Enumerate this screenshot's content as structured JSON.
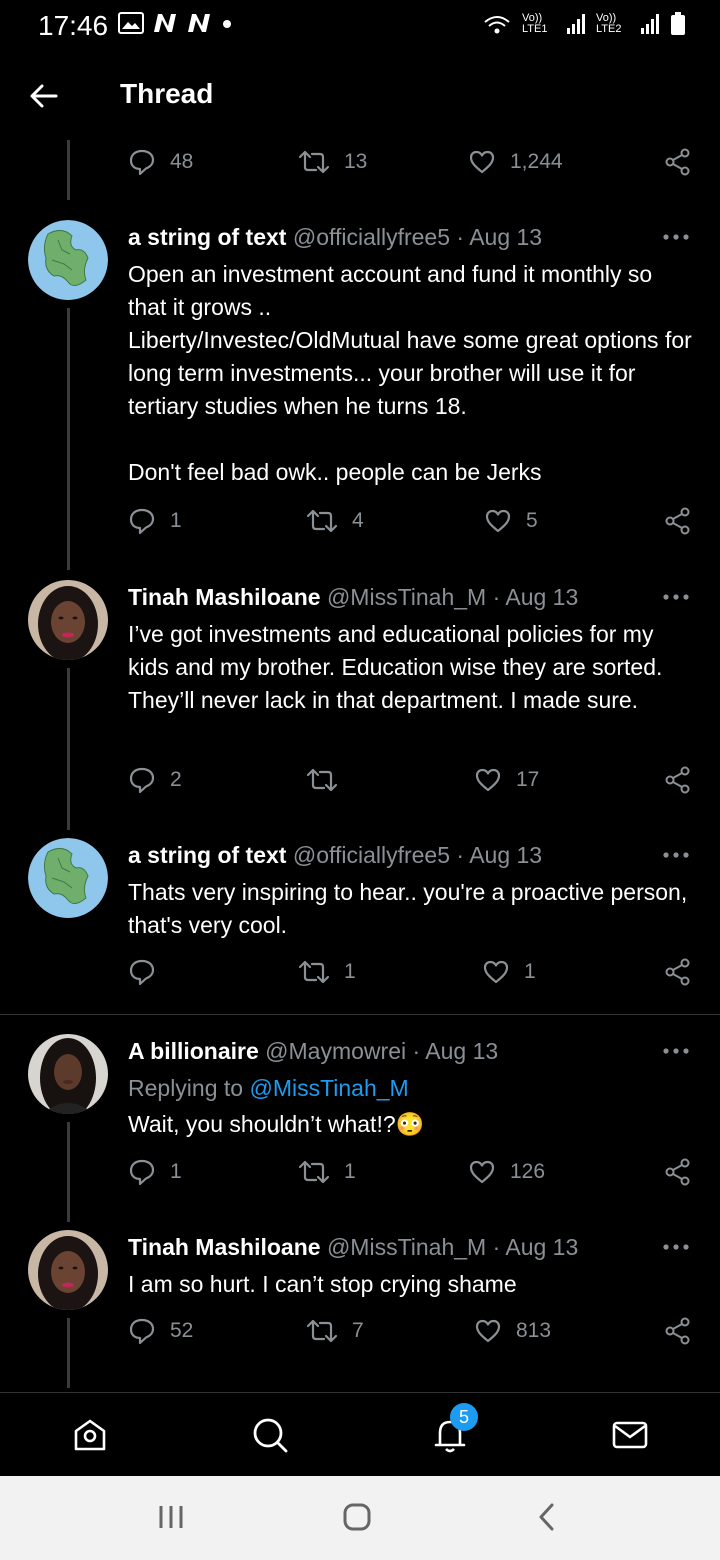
{
  "status_bar": {
    "time": "17:46",
    "net1": "Vo)) LTE1",
    "net2": "Vo)) LTE2"
  },
  "header": {
    "title": "Thread"
  },
  "top_actions": {
    "replies": "48",
    "retweets": "13",
    "likes": "1,244"
  },
  "tweets": [
    {
      "name": "a string of text",
      "meta": "@officiallyfree5 · Aug 13",
      "reply_to_prefix": "",
      "reply_to_handle": "",
      "body": "Open an investment account and fund it monthly so that it grows ..\nLiberty/Investec/OldMutual have some great options for long term investments... your brother will use it for tertiary studies when he turns 18.\n\nDon't feel bad owk.. people can be Jerks",
      "replies": "1",
      "retweets": "4",
      "likes": "5",
      "avatar": "globe-avatar"
    },
    {
      "name": "Tinah Mashiloane",
      "meta": "@MissTinah_M · Aug 13",
      "reply_to_prefix": "",
      "reply_to_handle": "",
      "body": "I’ve got investments and educational policies for my kids and my brother. Education wise they are sorted. They’ll never lack in that department. I made sure.",
      "replies": "2",
      "retweets": "",
      "likes": "17",
      "avatar": "woman-avatar"
    },
    {
      "name": "a string of text",
      "meta": "@officiallyfree5 · Aug 13",
      "reply_to_prefix": "",
      "reply_to_handle": "",
      "body": "Thats very inspiring to hear.. you're a proactive person, that's very cool.",
      "replies": "",
      "retweets": "1",
      "likes": "1",
      "avatar": "globe-avatar"
    },
    {
      "name": "A billionaire",
      "meta": "@Maymowrei · Aug 13",
      "reply_to_prefix": "Replying to ",
      "reply_to_handle": "@MissTinah_M",
      "body": "Wait, you shouldn’t what!?😳",
      "replies": "1",
      "retweets": "1",
      "likes": "126",
      "avatar": "woman-avatar-2"
    },
    {
      "name": "Tinah Mashiloane",
      "meta": "@MissTinah_M · Aug 13",
      "reply_to_prefix": "",
      "reply_to_handle": "",
      "body": "I am so hurt. I can’t stop crying shame",
      "replies": "52",
      "retweets": "7",
      "likes": "813",
      "avatar": "woman-avatar"
    }
  ],
  "bottom_nav": {
    "notifications_badge": "5",
    "items": [
      "home-icon",
      "search-icon",
      "bell-icon",
      "mail-icon"
    ]
  },
  "colors": {
    "accent": "#1d9bf0",
    "muted": "#8b9096",
    "background": "#000000"
  }
}
